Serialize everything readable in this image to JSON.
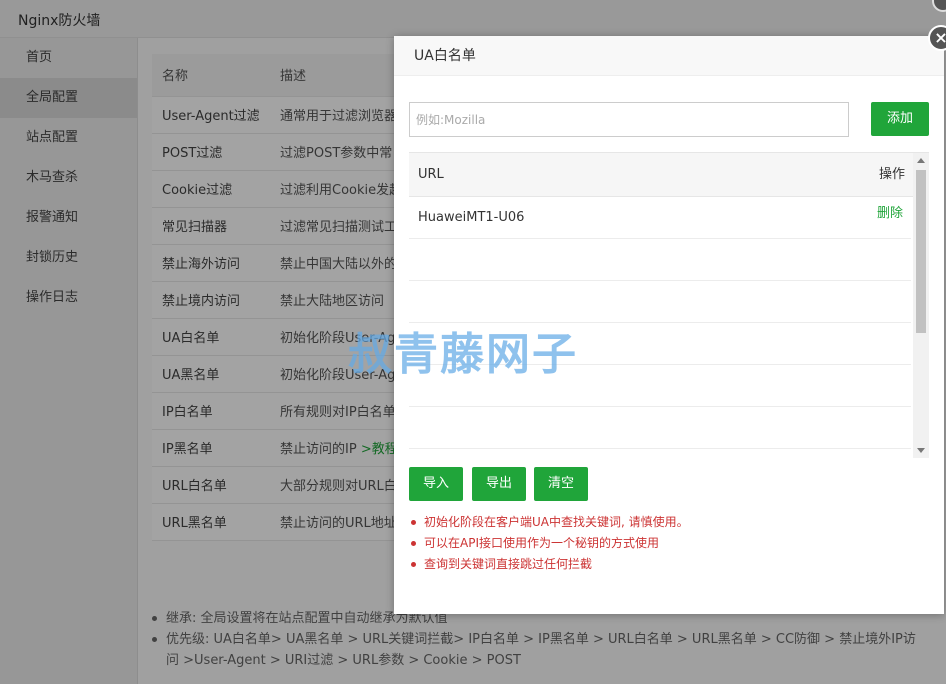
{
  "app": {
    "title": "Nginx防火墙"
  },
  "sidebar": {
    "items": [
      {
        "label": "首页"
      },
      {
        "label": "全局配置"
      },
      {
        "label": "站点配置"
      },
      {
        "label": "木马查杀"
      },
      {
        "label": "报警通知"
      },
      {
        "label": "封锁历史"
      },
      {
        "label": "操作日志"
      }
    ]
  },
  "rules_table": {
    "headers": {
      "name": "名称",
      "desc": "描述"
    },
    "rows": [
      {
        "name": "User-Agent过滤",
        "desc": "通常用于过滤浏览器"
      },
      {
        "name": "POST过滤",
        "desc": "过滤POST参数中常"
      },
      {
        "name": "Cookie过滤",
        "desc": "过滤利用Cookie发起"
      },
      {
        "name": "常见扫描器",
        "desc": "过滤常见扫描测试工"
      },
      {
        "name": "禁止海外访问",
        "desc": "禁止中国大陆以外的"
      },
      {
        "name": "禁止境内访问",
        "desc": "禁止大陆地区访问"
      },
      {
        "name": "UA白名单",
        "desc": "初始化阶段User-Ag"
      },
      {
        "name": "UA黑名单",
        "desc": "初始化阶段User-Ag"
      },
      {
        "name": "IP白名单",
        "desc": "所有规则对IP白名单"
      },
      {
        "name": "IP黑名单",
        "desc": "禁止访问的IP",
        "link": ">教程"
      },
      {
        "name": "URL白名单",
        "desc": "大部分规则对URL白"
      },
      {
        "name": "URL黑名单",
        "desc": "禁止访问的URL地址"
      }
    ]
  },
  "bottom_notes": [
    "继承: 全局设置将在站点配置中自动继承为默认值",
    "优先级: UA白名单> UA黑名单 > URL关键词拦截> IP白名单 > IP黑名单 > URL白名单 > URL黑名单 > CC防御 > 禁止境外IP访问 >User-Agent > URI过滤 > URL参数 > Cookie > POST"
  ],
  "modal": {
    "title": "UA白名单",
    "close_label": "×",
    "input": {
      "value": "",
      "placeholder": "例如:Mozilla"
    },
    "add_label": "添加",
    "list": {
      "col_url": "URL",
      "col_op": "操作",
      "rows": [
        {
          "url": "HuaweiMT1-U06",
          "action": "删除"
        }
      ]
    },
    "buttons": {
      "import": "导入",
      "export": "导出",
      "clear": "清空"
    },
    "tips": [
      "初始化阶段在客户端UA中查找关键词, 请慎使用。",
      "可以在API接口使用作为一个秘钥的方式使用",
      "查询到关键词直接跳过任何拦截"
    ]
  },
  "watermark": "叔青藤网子",
  "colors": {
    "accent": "#20a53a",
    "tip": "#cc3333"
  }
}
